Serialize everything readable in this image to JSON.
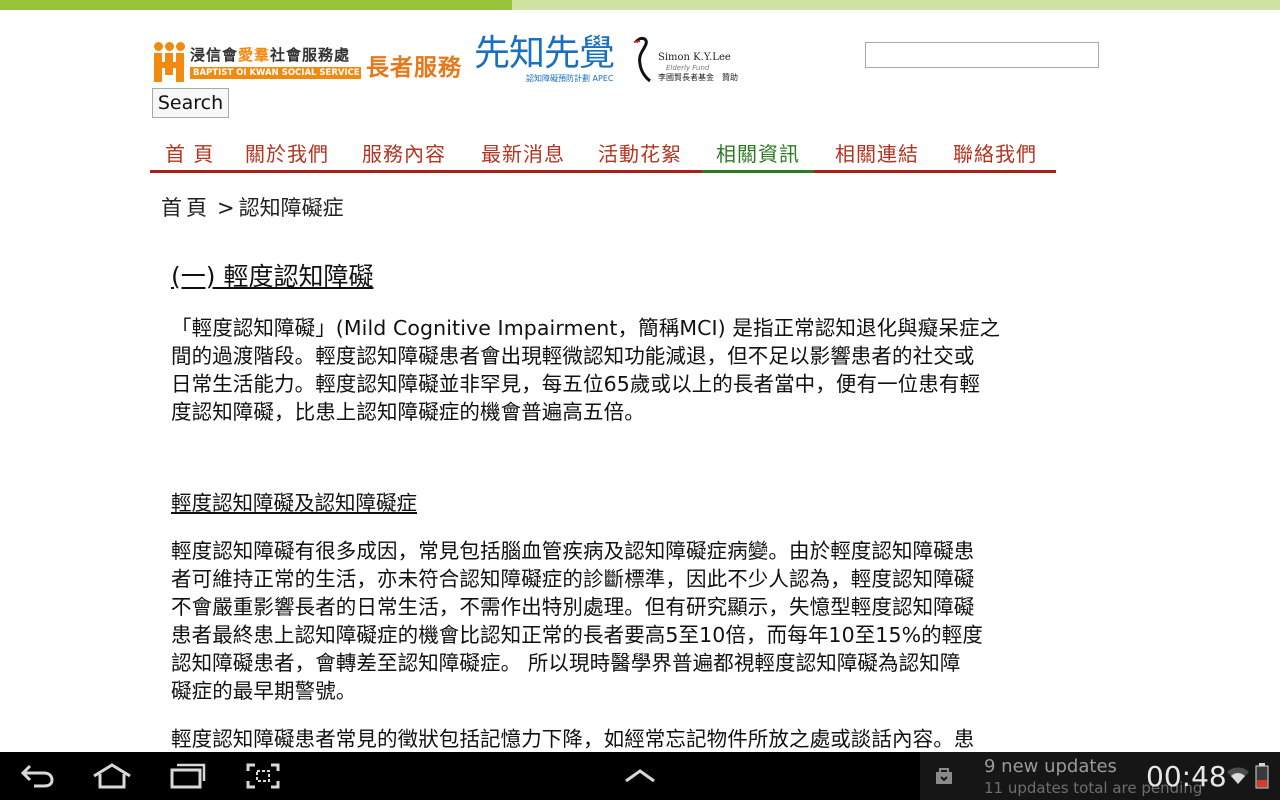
{
  "page_load": {
    "progress_percent": 40
  },
  "header": {
    "oikwan_name_pre": "浸信會",
    "oikwan_name_hl": "愛羣",
    "oikwan_name_post": "社會服務處",
    "oikwan_name_en": "BAPTIST OI KWAN SOCIAL SERVICE",
    "elderly_service": "長者服務",
    "apec_title": "先知先覺",
    "apec_subtitle": "認知障礙預防計劃 APEC",
    "simon_name": "Simon K.Y.Lee",
    "simon_fund": "Elderly Fund",
    "simon_cn": "李國賢長者基金　贊助"
  },
  "search": {
    "value": "",
    "button_label": "Search"
  },
  "nav": {
    "items": [
      {
        "label": "首 頁"
      },
      {
        "label": "關於我們"
      },
      {
        "label": "服務內容"
      },
      {
        "label": "最新消息"
      },
      {
        "label": "活動花絮"
      },
      {
        "label": "相關資訊"
      },
      {
        "label": "相關連結"
      },
      {
        "label": "聯絡我們"
      }
    ],
    "active_index": 5
  },
  "breadcrumb": {
    "home": "首頁",
    "separator": ">",
    "current": "認知障礙症"
  },
  "article": {
    "title": "(一) 輕度認知障礙",
    "p1_line1": "「輕度認知障礙」(Mild Cognitive Impairment，簡稱MCI) 是指正常認知退化與癡呆症之",
    "p1_line2": "間的過渡階段。輕度認知障礙患者會出現輕微認知功能減退，但不足以影響患者的社交或",
    "p1_line3": "日常生活能力。輕度認知障礙並非罕見，每五位65歲或以上的長者當中，便有一位患有輕",
    "p1_line4": "度認知障礙，比患上認知障礙症的機會普遍高五倍。",
    "subheading": "輕度認知障礙及認知障礙症",
    "p2_line1": "輕度認知障礙有很多成因，常見包括腦血管疾病及認知障礙症病變。由於輕度認知障礙患",
    "p2_line2": "者可維持正常的生活，亦未符合認知障礙症的診斷標準，因此不少人認為，輕度認知障礙",
    "p2_line3": "不會嚴重影響長者的日常生活，不需作出特別處理。但有研究顯示，失憶型輕度認知障礙",
    "p2_line4": "患者最終患上認知障礙症的機會比認知正常的長者要高5至10倍，而每年10至15%的輕度",
    "p2_line5": "認知障礙患者，會轉差至認知障礙症。 所以現時醫學界普遍都視輕度認知障礙為認知障",
    "p2_line6": "礙症的最早期警號。",
    "p3_line1": "輕度認知障礙患者常見的徵狀包括記憶力下降，如經常忘記物件所放之處或談話內容。患"
  },
  "system_bar": {
    "notification_title": "9 new updates",
    "notification_sub": "11 updates total are pending",
    "clock": "00:48"
  },
  "colors": {
    "progress_fill": "#99c33b",
    "progress_track": "#cfe2a2",
    "nav_text": "#b33421",
    "nav_active": "#2d7a23",
    "nav_rule": "#a82018",
    "logo_orange": "#f28a12",
    "logo_blue": "#1a6fc0"
  }
}
